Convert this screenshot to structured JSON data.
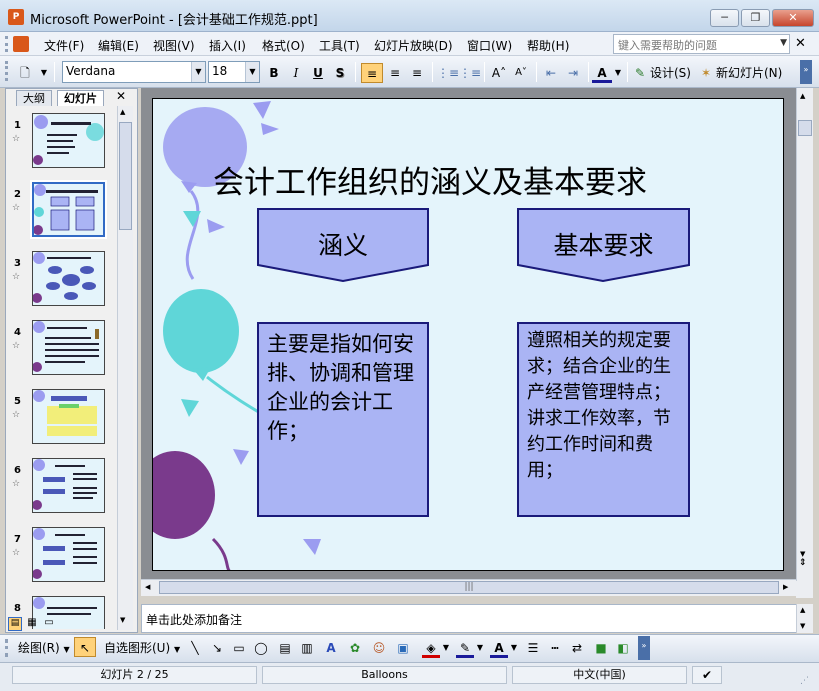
{
  "window": {
    "title": "Microsoft PowerPoint - [会计基础工作规范.ppt]",
    "minimize": "─",
    "restore": "❐",
    "close": "✕"
  },
  "menu": {
    "items": [
      "文件(F)",
      "编辑(E)",
      "视图(V)",
      "插入(I)",
      "格式(O)",
      "工具(T)",
      "幻灯片放映(D)",
      "窗口(W)",
      "帮助(H)"
    ],
    "help_placeholder": "键入需要帮助的问题",
    "close": "✕"
  },
  "toolbar": {
    "font": "Verdana",
    "size": "18",
    "bold": "B",
    "italic": "I",
    "underline": "U",
    "shadow": "S",
    "design_label": "设计(S)",
    "new_slide_label": "新幻灯片(N)"
  },
  "panel": {
    "tabs": [
      "大纲",
      "幻灯片"
    ],
    "close": "✕"
  },
  "thumbnails": [
    "1",
    "2",
    "3",
    "4",
    "5",
    "6",
    "7",
    "8"
  ],
  "slide": {
    "title": "会计工作组织的涵义及基本要求",
    "box1_title": "涵义",
    "box2_title": "基本要求",
    "box1_body": "主要是指如何安排、协调和管理企业的会计工作；",
    "box2_body": "遵照相关的规定要求；结合企业的生产经营管理特点；讲求工作效率，节约工作时间和费用；"
  },
  "notes": {
    "placeholder": "单击此处添加备注"
  },
  "drawbar": {
    "draw_label": "绘图(R)",
    "autoshape_label": "自选图形(U)"
  },
  "status": {
    "slide_info": "幻灯片 2 / 25",
    "template": "Balloons",
    "language": "中文(中国)"
  },
  "colors": {
    "accent": "#316ac5",
    "slide_bg": "#e4f4fb",
    "box_fill": "#aab4f4",
    "box_border": "#1a1a7a"
  }
}
